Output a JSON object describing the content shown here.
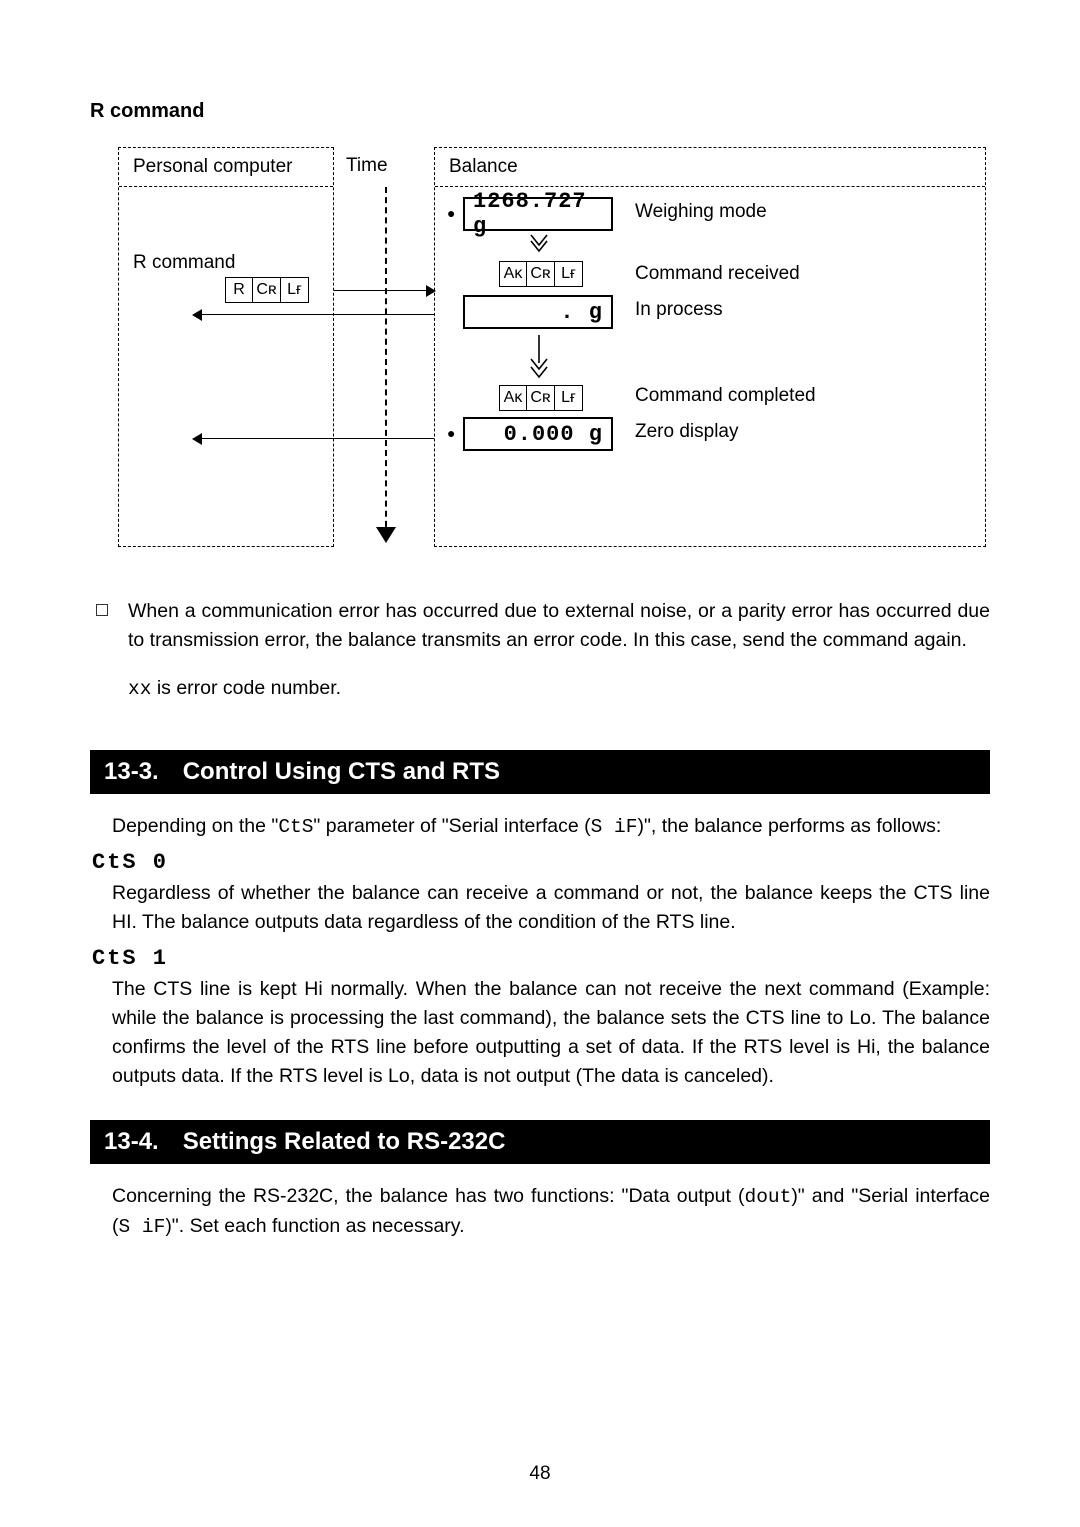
{
  "page_number": "48",
  "r_command": {
    "heading": "R command",
    "pc_header": "Personal computer",
    "time_header": "Time",
    "balance_header": "Balance",
    "rcmd_label": "R command",
    "rcmd_chars": [
      "R",
      "Cʀ",
      "Lғ"
    ],
    "weighing_display": "1268.727 g",
    "weighing_label": "Weighing mode",
    "ack_chars": [
      "Aᴋ",
      "Cʀ",
      "Lғ"
    ],
    "received_label": "Command received",
    "inprocess_display": ".          g",
    "inprocess_label": "In process",
    "completed_label": "Command completed",
    "zero_display": "0.000 g",
    "zero_label": "Zero display"
  },
  "error_note": {
    "p1": "When a communication error has occurred due to external noise, or a parity error has occurred due to transmission error, the balance transmits an error code. In this case, send the command again.",
    "p2_prefix": "xx",
    "p2_rest": " is error code number."
  },
  "section_13_3": {
    "num": "13-3.",
    "title": "Control Using CTS and RTS",
    "intro_a": "Depending on the \"",
    "intro_seg1": "CtS",
    "intro_b": "\" parameter of \"Serial interface (",
    "intro_seg2": "S iF",
    "intro_c": ")\", the balance performs as follows:",
    "cts0_label": "CtS 0",
    "cts0_body": "Regardless of whether the balance can receive a command or not, the balance keeps the CTS line HI. The balance outputs data regardless of the condition of the RTS line.",
    "cts1_label": "CtS  1",
    "cts1_body": "The CTS line is kept Hi normally. When the balance can not receive the next command (Example: while the balance is processing the last command), the balance sets the CTS line to Lo. The balance confirms the level of the RTS line before outputting a set of data. If the RTS level is Hi, the balance outputs data. If the RTS level is Lo, data is not output (The data is canceled)."
  },
  "section_13_4": {
    "num": "13-4.",
    "title": "Settings Related to RS-232C",
    "body_a": "Concerning the RS-232C, the balance has two functions: \"Data output (",
    "body_seg1": "dout",
    "body_b": ")\" and \"Serial interface (",
    "body_seg2": "S iF",
    "body_c": ")\". Set each function as necessary."
  }
}
